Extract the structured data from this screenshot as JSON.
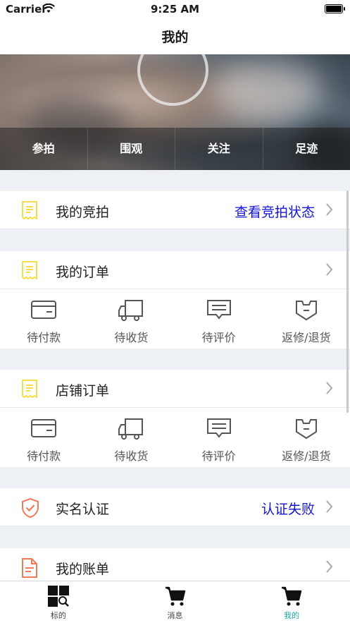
{
  "status": {
    "carrier": "Carrier",
    "time": "9:25 AM"
  },
  "nav": {
    "title": "我的"
  },
  "hero_tabs": [
    "参拍",
    "围观",
    "关注",
    "足迹"
  ],
  "rows": {
    "auction": {
      "label": "我的竞拍",
      "value": "查看竞拍状态"
    },
    "orders": {
      "label": "我的订单"
    },
    "shop_orders": {
      "label": "店铺订单"
    },
    "verify": {
      "label": "实名认证",
      "value": "认证失败"
    },
    "bill": {
      "label": "我的账单"
    }
  },
  "quick_actions": [
    "待付款",
    "待收货",
    "待评价",
    "返修/退货"
  ],
  "tabbar": [
    "标的",
    "消息",
    "我的"
  ],
  "colors": {
    "link_blue": "#1414d4",
    "accent_teal": "#1aa89f",
    "icon_yellow": "#f2df4a",
    "icon_orange": "#f07a5a"
  }
}
